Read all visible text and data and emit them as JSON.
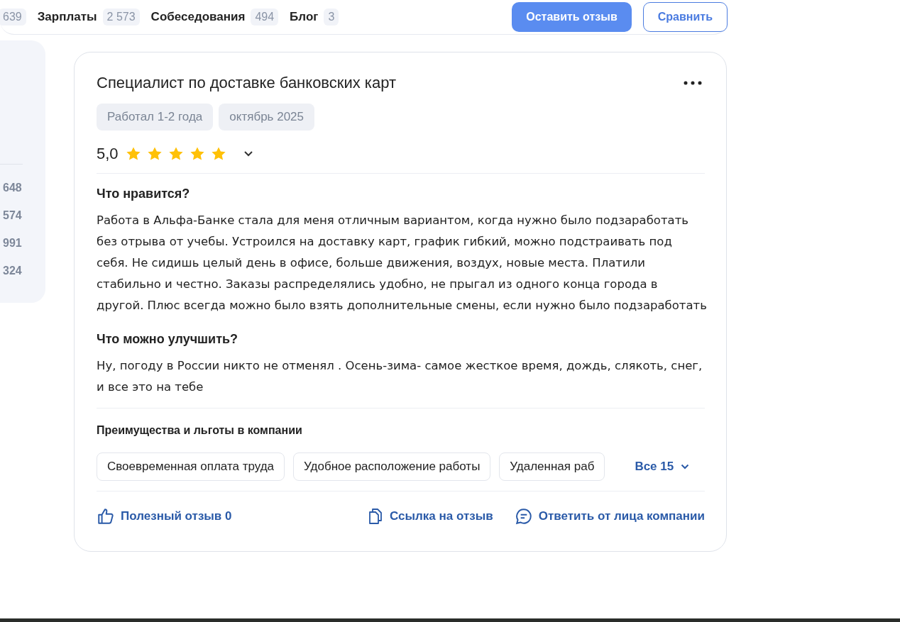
{
  "nav": [
    {
      "count": "639"
    },
    {
      "label": "Зарплаты",
      "count": "2 573"
    },
    {
      "label": "Собеседования",
      "count": "494"
    },
    {
      "label": "Блог",
      "count": "3"
    }
  ],
  "actions": {
    "primary": "Оставить отзыв",
    "secondary": "Сравнить"
  },
  "sidebar": {
    "counts": [
      "648",
      "574",
      "991",
      "324"
    ]
  },
  "review": {
    "title": "Специалист по доставке банковских карт",
    "tags": [
      "Работал 1-2 года",
      "октябрь 2025"
    ],
    "rating": "5,0",
    "stars": 5,
    "sections": [
      {
        "heading": "Что нравится?",
        "text": "Работа в Альфа-Банке стала для меня отличным вариантом, когда нужно было подзаработать без отрыва от учебы. Устроился на доставку карт, график гибкий, можно подстраивать под себя. Не сидишь целый день в офисе, больше движения, воздух, новые места. Платили стабильно и честно. Заказы распределялись удобно, не прыгал из одного конца города в другой. Плюс всегда можно было взять дополнительные смены, если нужно было подзаработать"
      },
      {
        "heading": "Что можно улучшить?",
        "text": "Ну, погоду в России никто не отменял . Осень-зима- самое жесткое время, дождь, слякоть, снег, и все это на тебе"
      }
    ],
    "benefits_title": "Преимущества и льготы в компании",
    "benefits": [
      "Своевременная оплата труда",
      "Удобное расположение работы",
      "Удаленная раб"
    ],
    "benefits_more": "Все 15",
    "footer": [
      {
        "kind": "like",
        "label": "Полезный отзыв 0"
      },
      {
        "kind": "link",
        "label": "Ссылка на отзыв"
      },
      {
        "kind": "reply",
        "label": "Ответить от лица компании"
      }
    ]
  }
}
